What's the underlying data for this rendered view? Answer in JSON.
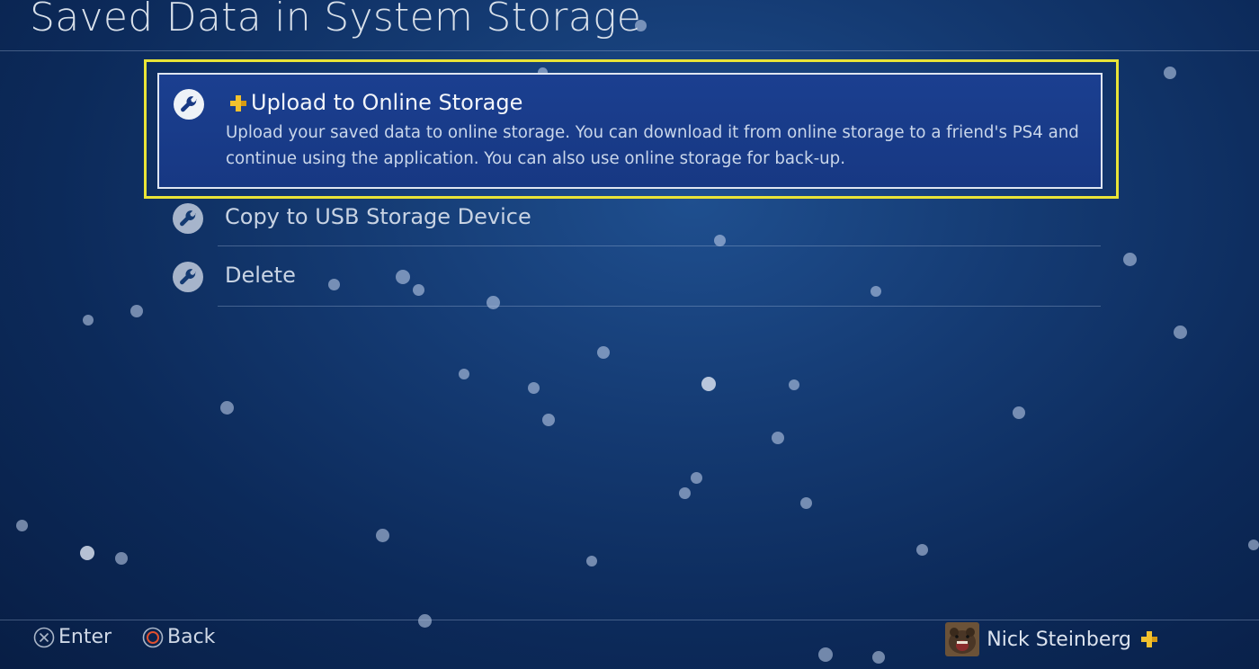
{
  "header": {
    "title": "Saved Data in System Storage"
  },
  "menu": {
    "items": [
      {
        "label": "Upload to Online Storage",
        "description": "Upload your saved data to online storage. You can download it from online storage to a friend's PS4 and continue using the application. You can also use online storage for back-up.",
        "icon": "wrench-icon",
        "badge": "ps-plus-icon",
        "selected": true
      },
      {
        "label": "Copy to USB Storage Device",
        "icon": "wrench-icon"
      },
      {
        "label": "Delete",
        "icon": "wrench-icon"
      }
    ]
  },
  "footer": {
    "enter_label": "Enter",
    "back_label": "Back",
    "user_name": "Nick Steinberg"
  },
  "colors": {
    "highlight": "#e9e437",
    "ps_plus": "#f2c12e",
    "background": "#0c2a5a"
  }
}
